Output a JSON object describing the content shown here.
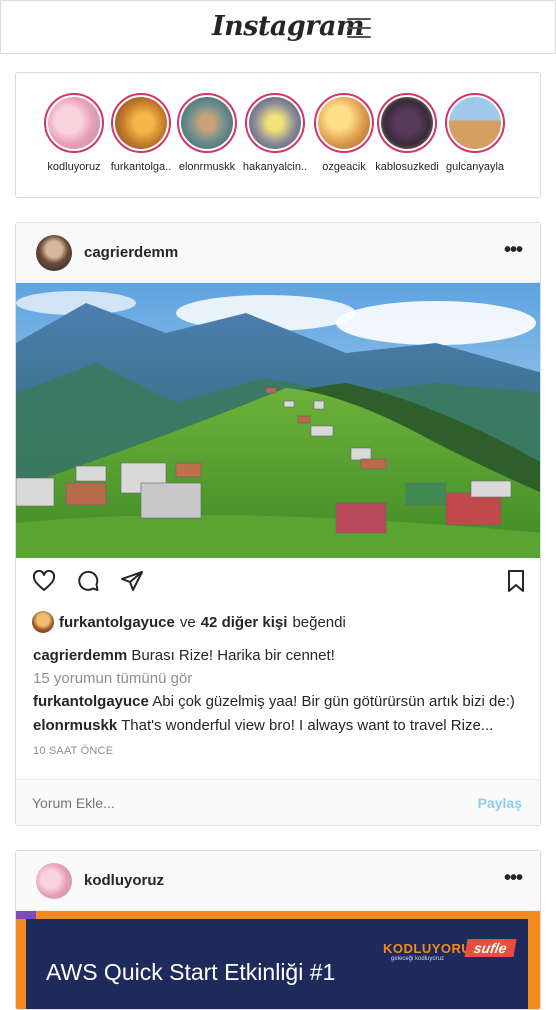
{
  "app": {
    "logo": "Instagram"
  },
  "stories": [
    {
      "name": "kodluyoruz"
    },
    {
      "name": "furkantolga.."
    },
    {
      "name": "elonrmuskk"
    },
    {
      "name": "hakanyalcin.."
    },
    {
      "name": "ozgeacik"
    },
    {
      "name": "kablosuzkedi"
    },
    {
      "name": "gulcanyayla"
    }
  ],
  "post1": {
    "username": "cagrierdemm",
    "more": "•••",
    "likes": {
      "user": "furkantolgayuce",
      "connector": "ve",
      "others": "42 diğer kişi",
      "suffix": "beğendi"
    },
    "caption": {
      "user": "cagrierdemm",
      "text": "Burası Rize! Harika bir cennet!"
    },
    "view_all": "15 yorumun tümünü gör",
    "comments": [
      {
        "user": "furkantolgayuce",
        "text": "Abi çok güzelmiş yaa! Bir gün götürürsün artık bizi de:)"
      },
      {
        "user": "elonrmuskk",
        "text": "That's wonderful view bro! I always want to travel Rize..."
      }
    ],
    "time": "10 SAAT ÖNCE",
    "comment_placeholder": "Yorum Ekle...",
    "share_label": "Paylaş"
  },
  "post2": {
    "username": "kodluyoruz",
    "more": "•••",
    "banner": {
      "title": "AWS Quick Start Etkinliği #1",
      "brand": "KODLUYORUZ",
      "brand_sub": "geleceği kodluyoruz",
      "partner": "sufle"
    }
  }
}
